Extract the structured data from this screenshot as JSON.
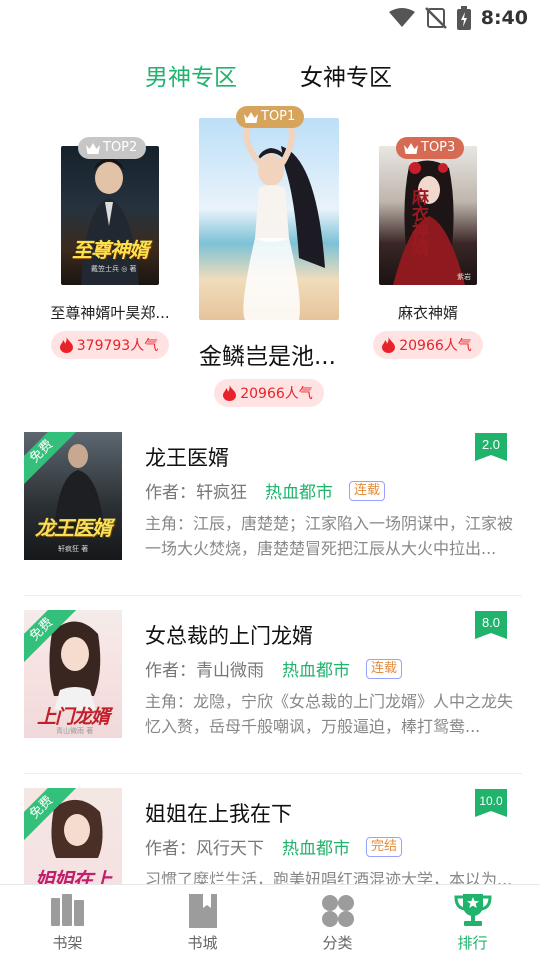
{
  "status_bar": {
    "time": "8:40"
  },
  "tabs": [
    {
      "label": "男神专区",
      "active": true
    },
    {
      "label": "女神专区",
      "active": false
    }
  ],
  "top_books": [
    {
      "rank": "TOP1",
      "title": "金鳞岂是池...",
      "popularity": "20966人气"
    },
    {
      "rank": "TOP2",
      "title": "至尊神婿叶昊郑...",
      "popularity": "379793人气"
    },
    {
      "rank": "TOP3",
      "title": "麻衣神婿",
      "popularity": "20966人气"
    }
  ],
  "covers": {
    "top2_text": "至尊神婿",
    "top2_author": "戴笠士兵 ◎ 著",
    "top3_text": "麻衣神婿",
    "top3_author": "紫岩",
    "free_label": "免费"
  },
  "book_list": [
    {
      "title": "龙王医婿",
      "author": "作者：轩疯狂",
      "genre": "热血都市",
      "status": "连载",
      "score": "2.0",
      "desc": "主角：江辰，唐楚楚；江家陷入一场阴谋中，江家被一场大火焚烧，唐楚楚冒死把江辰从大火中拉出...",
      "cover_text": "龙王医婿",
      "cover_author": "轩疯狂 著"
    },
    {
      "title": "女总裁的上门龙婿",
      "author": "作者：青山微雨",
      "genre": "热血都市",
      "status": "连载",
      "score": "8.0",
      "desc": "主角：龙隐，宁欣《女总裁的上门龙婿》人中之龙失忆入赘，岳母千般嘲讽，万般逼迫，棒打鸳鸯...",
      "cover_text": "上门龙婿",
      "cover_author": "青山微雨 著"
    },
    {
      "title": "姐姐在上我在下",
      "author": "作者：风行天下",
      "genre": "热血都市",
      "status": "完结",
      "score": "10.0",
      "desc": "习惯了糜烂生活，跑美妞唱红酒混迹大学，本以为...",
      "cover_text": "姐姐在上",
      "cover_author": ""
    }
  ],
  "bottom_nav": [
    {
      "label": "书架",
      "icon": "bookshelf-icon",
      "active": false
    },
    {
      "label": "书城",
      "icon": "bookstore-icon",
      "active": false
    },
    {
      "label": "分类",
      "icon": "category-icon",
      "active": false
    },
    {
      "label": "排行",
      "icon": "trophy-icon",
      "active": true
    }
  ],
  "colors": {
    "accent": "#1fb36c",
    "popularity_text": "#e8222a",
    "popularity_bg": "#ffe3e3",
    "badge_top1": "#d7a45b",
    "badge_top2": "#c6c6c6",
    "badge_top3": "#d66a52",
    "status_tag_border": "#9aa2ff"
  }
}
